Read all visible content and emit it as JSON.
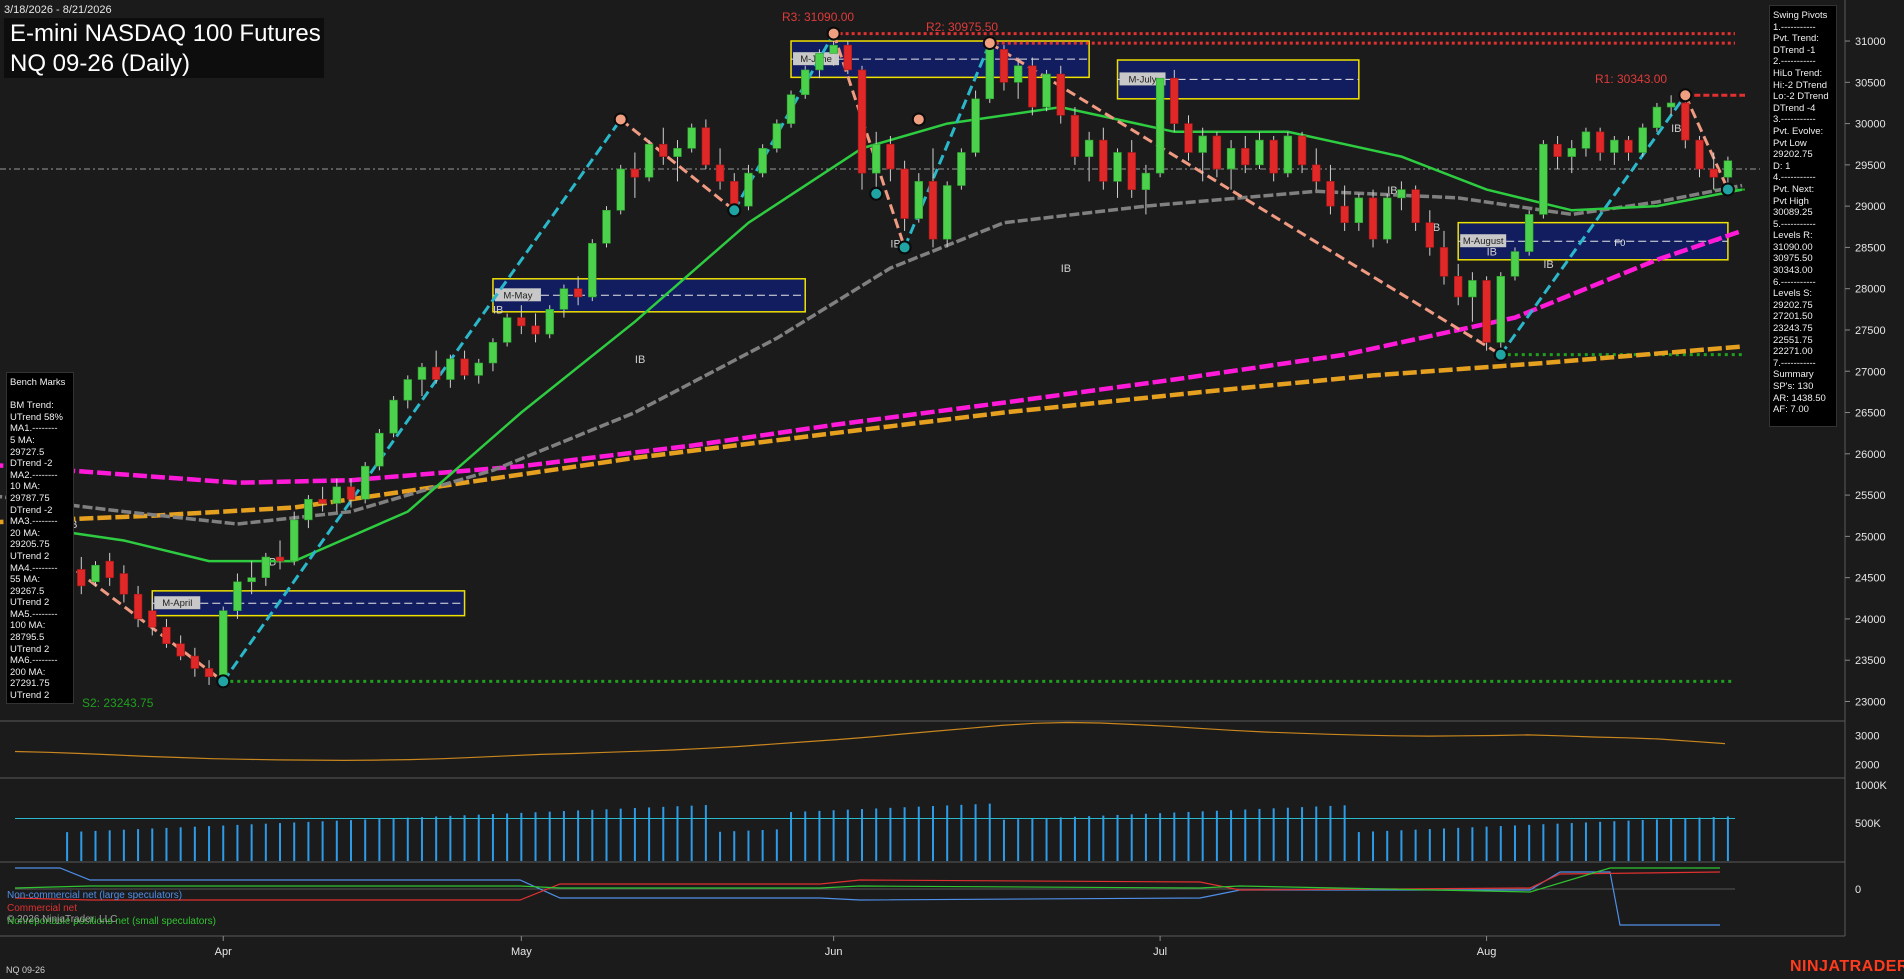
{
  "header": {
    "date_range": "3/18/2026 - 8/21/2026",
    "title_line1": "E-mini NASDAQ 100 Futures",
    "title_line2": "NQ 09-26 (Daily)"
  },
  "pivot_labels": {
    "r3": "R3: 31090.00",
    "r2": "R2: 30975.50",
    "r1": "R1: 30343.00",
    "s2": "S2: 23243.75"
  },
  "swing_pivots_panel": [
    "Swing Pivots",
    "1.-----------",
    "Pvt. Trend:",
    "DTrend -1",
    "2.-----------",
    "HiLo Trend:",
    "Hi:-2 DTrend",
    "Lo:-2 DTrend",
    "DTrend -4",
    "3.-----------",
    "Pvt. Evolve:",
    "Pvt Low",
    "29202.75",
    "D: 1",
    "4.-----------",
    "Pvt. Next:",
    "Pvt High",
    "30089.25",
    "5.-----------",
    "Levels R:",
    "31090.00",
    "30975.50",
    "30343.00",
    "6.-----------",
    "Levels S:",
    "29202.75",
    "27201.50",
    "23243.75",
    "22551.75",
    "22271.00",
    "7.-----------",
    "Summary",
    "SP's: 130",
    "AR: 1438.50",
    "AF: 7.00"
  ],
  "bench_marks_panel": [
    "Bench Marks",
    "",
    "BM Trend:",
    "UTrend 58%",
    "MA1.--------",
    "5 MA:",
    "29727.5",
    "DTrend -2",
    "MA2.--------",
    "10 MA:",
    "29787.75",
    "DTrend -2",
    "MA3.--------",
    "20 MA:",
    "29205.75",
    "UTrend 2",
    "MA4.--------",
    "55 MA:",
    "29267.5",
    "UTrend 2",
    "MA5.--------",
    "100 MA:",
    "28795.5",
    "UTrend 2",
    "MA6.--------",
    "200 MA:",
    "27291.75",
    "UTrend 2"
  ],
  "zone_labels": {
    "april": "M-April",
    "may": "M-May",
    "june": "M-June",
    "july": "M-July",
    "august": "M-August",
    "f0": "F0",
    "ib": "IB"
  },
  "cot_legend": {
    "noncommercial": "Non-commercial net (large speculators)",
    "commercial": "Commercial net",
    "nonreportable": "Nonreportable positions net (small speculators)",
    "copyright": "© 2026 NinjaTrader, LLC"
  },
  "footer": {
    "instrument": "NQ 09-26",
    "brand": "NINJATRADER"
  },
  "colors": {
    "background": "#1b1b1b",
    "up_candle": "#4cd14c",
    "down_candle": "#e02828",
    "ma_fast": "#2ecc40",
    "ma_mid": "#808080",
    "ma_100": "#ff1ad9",
    "ma_200": "#e6a020",
    "swing_line_up": "#2ab7c9",
    "swing_line_down": "#f09a82",
    "resistance": "#e03030",
    "support": "#1fa01f",
    "volume": "#2e9be8",
    "atr": "#c9861e"
  },
  "chart_data": {
    "type": "candlestick",
    "title": "E-mini NASDAQ 100 Futures NQ 09-26 (Daily)",
    "x_month_labels": [
      "Apr",
      "May",
      "Jun",
      "Jul",
      "Aug"
    ],
    "y_ticks": [
      23000,
      23500,
      24000,
      24500,
      25000,
      25500,
      26000,
      26500,
      27000,
      27500,
      28000,
      28500,
      29000,
      29500,
      30000,
      30500,
      31000
    ],
    "ylim": [
      22800,
      31400
    ],
    "candles": [
      [
        24700,
        24900,
        24500,
        24600
      ],
      [
        24600,
        24750,
        24300,
        24400
      ],
      [
        24450,
        24700,
        24400,
        24650
      ],
      [
        24700,
        24800,
        24400,
        24500
      ],
      [
        24550,
        24650,
        24200,
        24300
      ],
      [
        24300,
        24400,
        23900,
        24000
      ],
      [
        24100,
        24250,
        23800,
        23900
      ],
      [
        23900,
        24000,
        23650,
        23700
      ],
      [
        23700,
        23800,
        23500,
        23550
      ],
      [
        23550,
        23650,
        23300,
        23400
      ],
      [
        23400,
        23500,
        23200,
        23300
      ],
      [
        23300,
        24150,
        23243,
        24100
      ],
      [
        24100,
        24550,
        24000,
        24450
      ],
      [
        24450,
        24700,
        24300,
        24500
      ],
      [
        24500,
        24800,
        24400,
        24750
      ],
      [
        24750,
        24950,
        24600,
        24700
      ],
      [
        24700,
        25300,
        24650,
        25200
      ],
      [
        25200,
        25500,
        25100,
        25450
      ],
      [
        25450,
        25600,
        25300,
        25400
      ],
      [
        25400,
        25700,
        25300,
        25600
      ],
      [
        25600,
        25700,
        25350,
        25450
      ],
      [
        25450,
        25900,
        25400,
        25850
      ],
      [
        25850,
        26300,
        25800,
        26250
      ],
      [
        26250,
        26700,
        26200,
        26650
      ],
      [
        26650,
        26950,
        26550,
        26900
      ],
      [
        26900,
        27100,
        26700,
        27050
      ],
      [
        27050,
        27250,
        26850,
        26900
      ],
      [
        26900,
        27200,
        26800,
        27150
      ],
      [
        27150,
        27250,
        26900,
        26950
      ],
      [
        26950,
        27150,
        26850,
        27100
      ],
      [
        27100,
        27400,
        27000,
        27350
      ],
      [
        27350,
        27700,
        27300,
        27650
      ],
      [
        27650,
        27800,
        27450,
        27550
      ],
      [
        27550,
        27700,
        27350,
        27450
      ],
      [
        27450,
        27800,
        27400,
        27750
      ],
      [
        27750,
        28050,
        27650,
        28000
      ],
      [
        28000,
        28150,
        27800,
        27900
      ],
      [
        27900,
        28600,
        27850,
        28550
      ],
      [
        28550,
        29000,
        28500,
        28950
      ],
      [
        28950,
        29500,
        28900,
        29450
      ],
      [
        29450,
        29650,
        29100,
        29350
      ],
      [
        29350,
        29800,
        29300,
        29750
      ],
      [
        29750,
        29950,
        29500,
        29600
      ],
      [
        29600,
        29800,
        29300,
        29700
      ],
      [
        29700,
        30000,
        29650,
        29950
      ],
      [
        29950,
        30050,
        29450,
        29500
      ],
      [
        29500,
        29700,
        29200,
        29300
      ],
      [
        29300,
        29400,
        28900,
        29000
      ],
      [
        29000,
        29500,
        28950,
        29400
      ],
      [
        29400,
        29750,
        29350,
        29700
      ],
      [
        29700,
        30050,
        29650,
        30000
      ],
      [
        30000,
        30400,
        29950,
        30350
      ],
      [
        30350,
        30700,
        30300,
        30650
      ],
      [
        30650,
        30900,
        30550,
        30850
      ],
      [
        30850,
        31090,
        30700,
        30950
      ],
      [
        30950,
        31000,
        30600,
        30650
      ],
      [
        30650,
        30700,
        29200,
        29400
      ],
      [
        29400,
        29900,
        29150,
        29750
      ],
      [
        29750,
        29850,
        29300,
        29450
      ],
      [
        29450,
        29550,
        28700,
        28850
      ],
      [
        28850,
        29400,
        28800,
        29300
      ],
      [
        29300,
        29700,
        28500,
        28600
      ],
      [
        28600,
        29300,
        28500,
        29250
      ],
      [
        29250,
        29700,
        29200,
        29650
      ],
      [
        29650,
        30400,
        29600,
        30300
      ],
      [
        30300,
        30975,
        30250,
        30900
      ],
      [
        30900,
        30950,
        30400,
        30500
      ],
      [
        30500,
        30800,
        30300,
        30700
      ],
      [
        30700,
        30800,
        30100,
        30200
      ],
      [
        30200,
        30650,
        30150,
        30600
      ],
      [
        30600,
        30700,
        30000,
        30100
      ],
      [
        30100,
        30200,
        29500,
        29600
      ],
      [
        29600,
        29900,
        29300,
        29800
      ],
      [
        29800,
        29950,
        29200,
        29300
      ],
      [
        29300,
        29700,
        29100,
        29650
      ],
      [
        29650,
        29800,
        29100,
        29200
      ],
      [
        29200,
        29500,
        28900,
        29400
      ],
      [
        29400,
        30600,
        29350,
        30550
      ],
      [
        30550,
        30650,
        29900,
        30000
      ],
      [
        30000,
        30100,
        29550,
        29650
      ],
      [
        29650,
        29950,
        29300,
        29850
      ],
      [
        29850,
        29900,
        29350,
        29450
      ],
      [
        29450,
        29800,
        29200,
        29700
      ],
      [
        29700,
        29850,
        29400,
        29500
      ],
      [
        29500,
        29900,
        29450,
        29800
      ],
      [
        29800,
        29850,
        29300,
        29400
      ],
      [
        29400,
        29900,
        29350,
        29850
      ],
      [
        29850,
        29900,
        29400,
        29500
      ],
      [
        29500,
        29700,
        29200,
        29300
      ],
      [
        29300,
        29500,
        28900,
        29000
      ],
      [
        29000,
        29250,
        28700,
        28800
      ],
      [
        28800,
        29150,
        28700,
        29100
      ],
      [
        29100,
        29200,
        28500,
        28600
      ],
      [
        28600,
        29150,
        28550,
        29100
      ],
      [
        29100,
        29300,
        28950,
        29200
      ],
      [
        29200,
        29250,
        28700,
        28800
      ],
      [
        28800,
        28950,
        28400,
        28500
      ],
      [
        28500,
        28700,
        28050,
        28150
      ],
      [
        28150,
        28300,
        27800,
        27900
      ],
      [
        27900,
        28200,
        27600,
        28100
      ],
      [
        28100,
        28150,
        27250,
        27350
      ],
      [
        27350,
        28200,
        27201,
        28150
      ],
      [
        28150,
        28500,
        28100,
        28450
      ],
      [
        28450,
        28950,
        28400,
        28900
      ],
      [
        28900,
        29800,
        28850,
        29750
      ],
      [
        29750,
        29850,
        29450,
        29600
      ],
      [
        29600,
        29800,
        29400,
        29700
      ],
      [
        29700,
        29950,
        29600,
        29900
      ],
      [
        29900,
        29950,
        29550,
        29650
      ],
      [
        29650,
        29850,
        29500,
        29800
      ],
      [
        29800,
        29850,
        29550,
        29650
      ],
      [
        29650,
        30000,
        29600,
        29950
      ],
      [
        29950,
        30250,
        29900,
        30200
      ],
      [
        30200,
        30343,
        30100,
        30250
      ],
      [
        30250,
        30300,
        29700,
        29800
      ],
      [
        29800,
        29850,
        29350,
        29450
      ],
      [
        29450,
        29650,
        29202,
        29350
      ],
      [
        29350,
        29600,
        29250,
        29550
      ]
    ],
    "indicator_panels": [
      "ATR",
      "Volume / Open Interest",
      "COT net positions"
    ],
    "grid": false
  }
}
